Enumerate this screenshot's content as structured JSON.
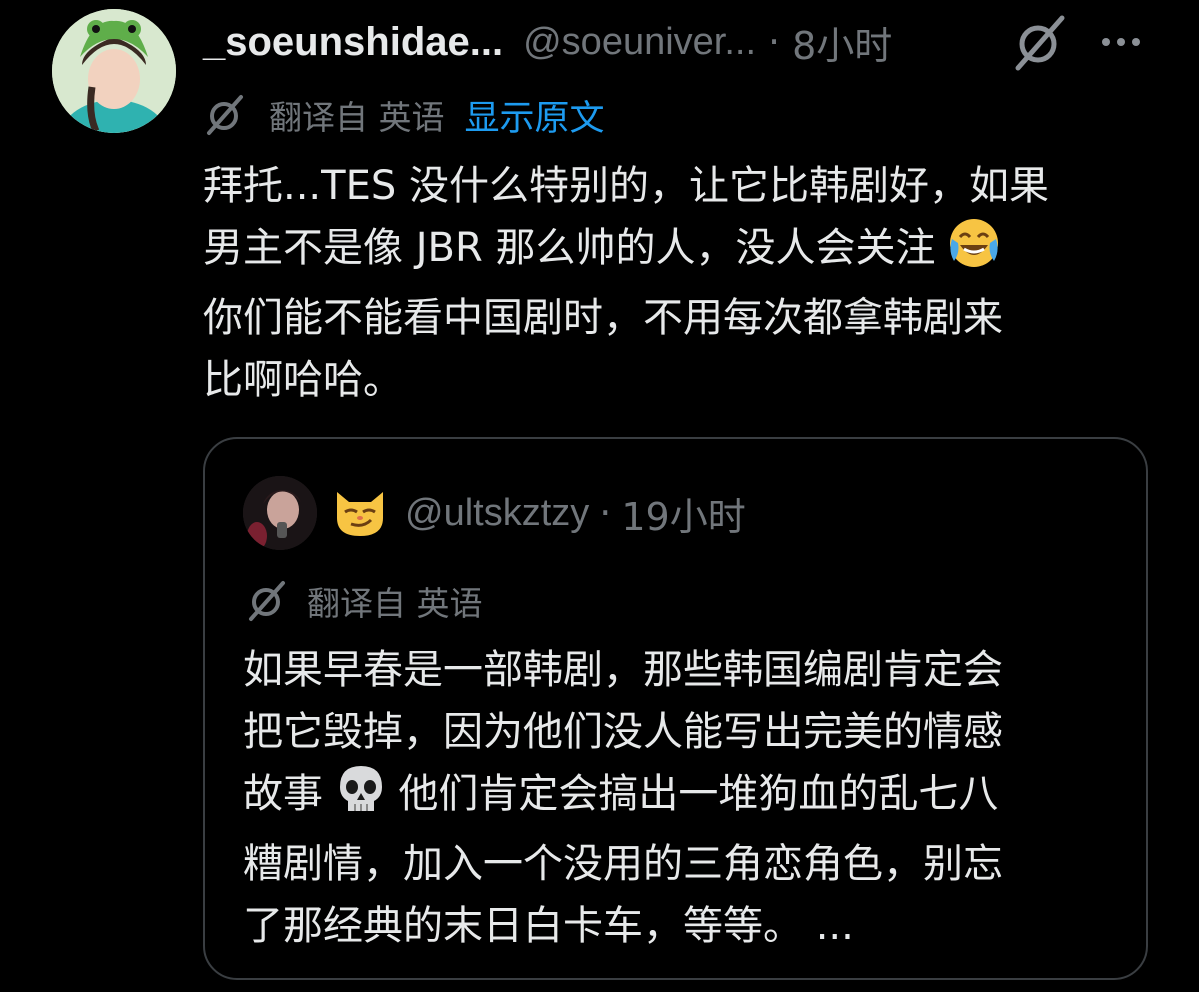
{
  "post": {
    "display_name": "_soeunshidae...",
    "handle": "@soeuniver...",
    "separator": "·",
    "time": "8小时",
    "translation_label": "翻译自 英语",
    "show_original": "显示原文",
    "text_lines": [
      "拜托...TES 没什么特别的，让它比韩剧好，如果",
      "男主不是像 JBR 那么帅的人，没人会关注",
      "你们能不能看中国剧时，不用每次都拿韩剧来",
      "比啊哈哈。"
    ],
    "emoji": "face-with-tears-of-joy"
  },
  "quote": {
    "handle": "@ultskztzy",
    "separator": "·",
    "time": "19小时",
    "name_emoji": "smirking-cat",
    "translation_label": "翻译自 英语",
    "text_lines": [
      "如果早春是一部韩剧，那些韩国编剧肯定会",
      "把它毁掉，因为他们没人能写出完美的情感",
      "故事",
      "他们肯定会搞出一堆狗血的乱七八",
      "糟剧情，加入一个没用的三角恋角色，别忘",
      "了那经典的末日白卡车，等等。 ..."
    ],
    "inline_emoji": "skull"
  },
  "colors": {
    "background": "#000000",
    "text": "#e7e9ea",
    "secondary": "#71767b",
    "link": "#1d9bf0",
    "border": "#3a3e42"
  }
}
